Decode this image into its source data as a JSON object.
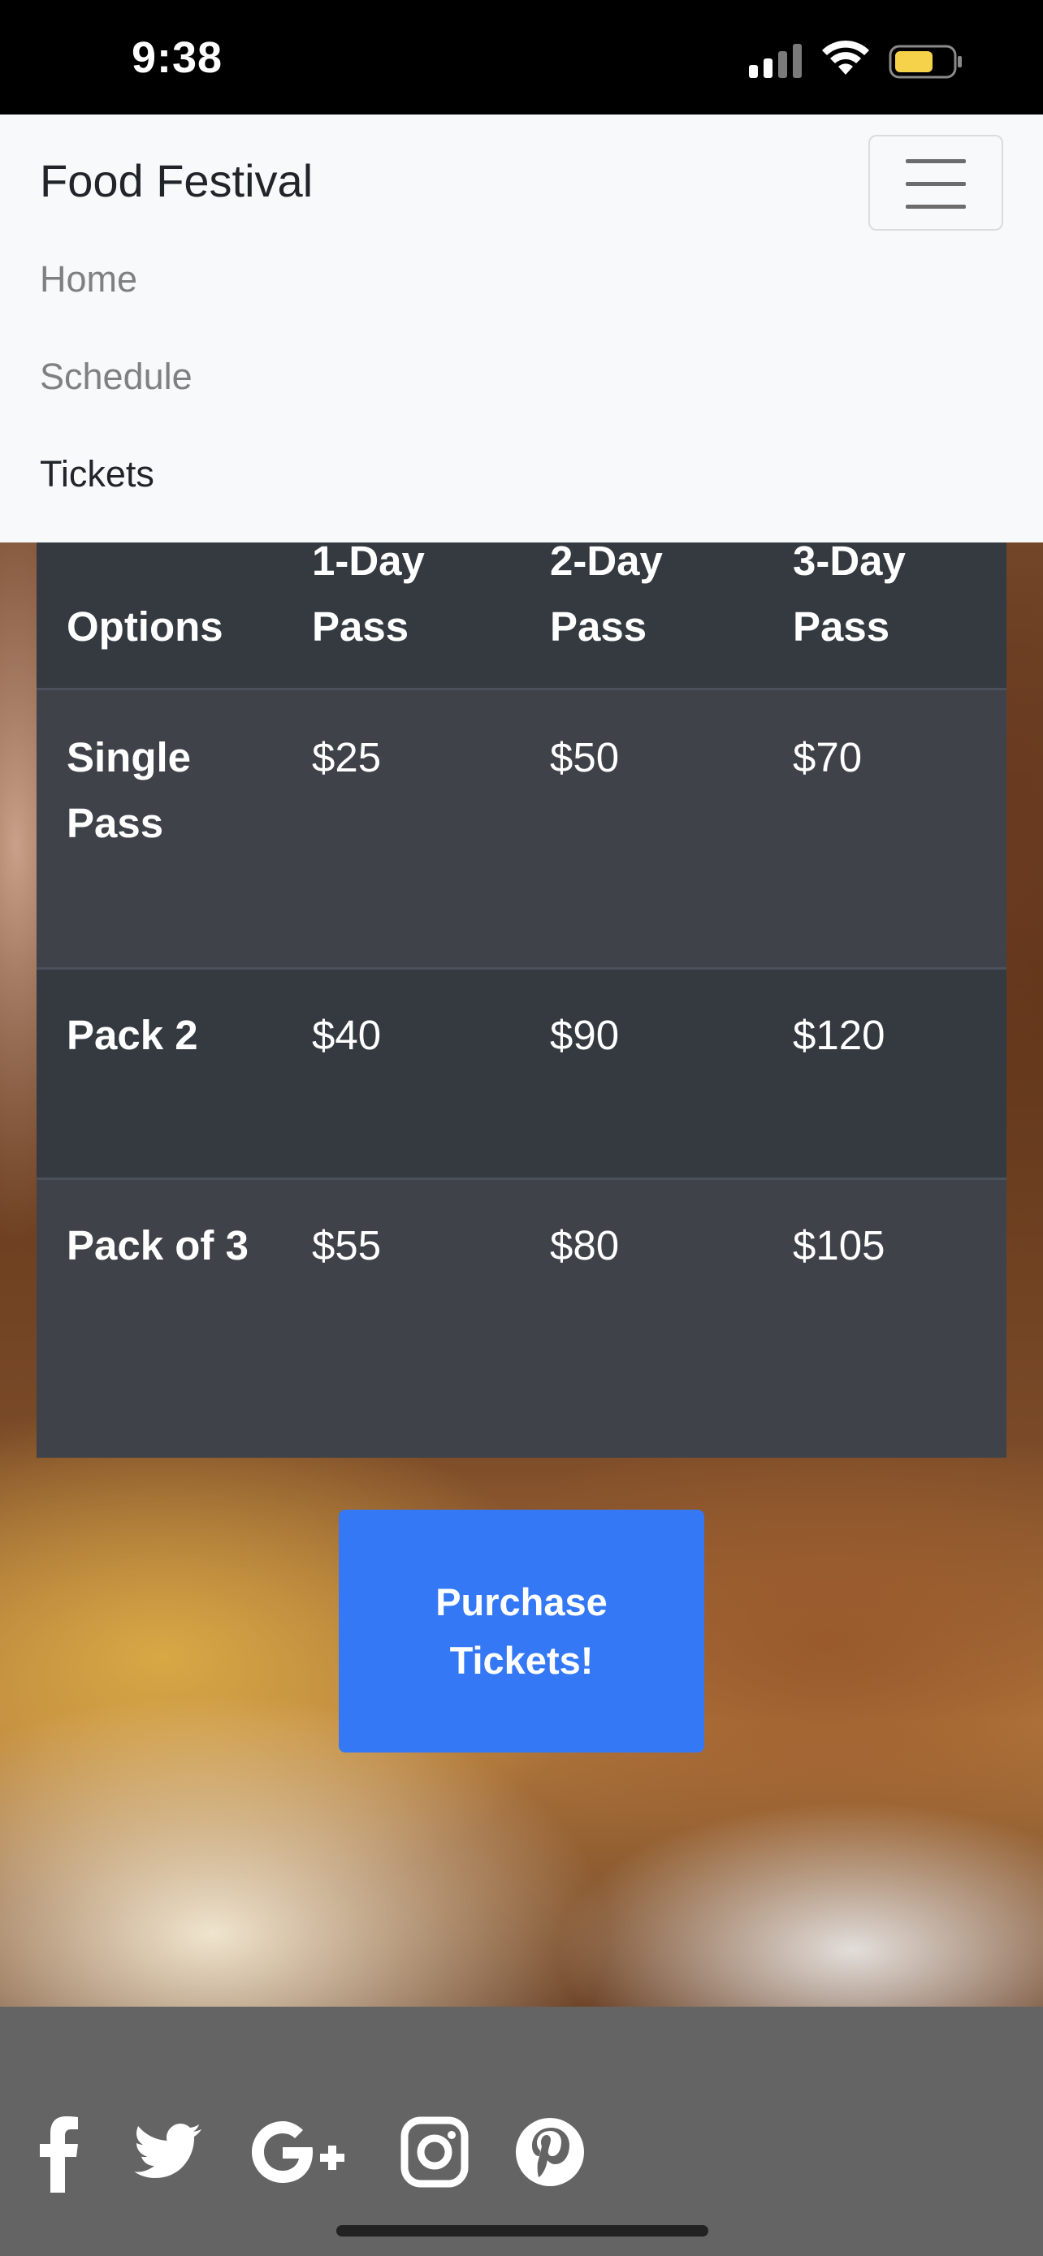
{
  "status_bar": {
    "time": "9:38"
  },
  "navbar": {
    "brand": "Food Festival",
    "links": [
      {
        "label": "Home"
      },
      {
        "label": "Schedule"
      },
      {
        "label": "Tickets"
      }
    ]
  },
  "table": {
    "header_partial": [
      "1-Day",
      "2-Day",
      "3-Day"
    ],
    "headers": [
      "Options",
      "Pass",
      "Pass",
      "Pass"
    ],
    "rows": [
      {
        "option": "Single Pass",
        "day1": "$25",
        "day2": "$50",
        "day3": "$70"
      },
      {
        "option": "Pack 2",
        "day1": "$40",
        "day2": "$90",
        "day3": "$120"
      },
      {
        "option": "Pack of 3",
        "day1": "$55",
        "day2": "$80",
        "day3": "$105"
      }
    ]
  },
  "purchase_button": {
    "label": "Purchase Tickets!"
  },
  "footer": {
    "social_icons": [
      "facebook-icon",
      "twitter-icon",
      "google-plus-icon",
      "instagram-icon",
      "pinterest-icon"
    ]
  },
  "colors": {
    "navbar_bg": "#f8f9fa",
    "table_bg": "#343a40",
    "button_bg": "#3478f6",
    "footer_bg": "#646464"
  }
}
